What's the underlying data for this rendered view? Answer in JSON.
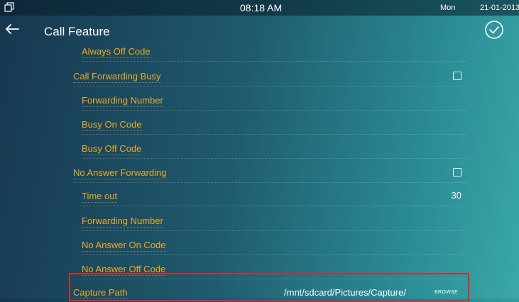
{
  "status_bar": {
    "time": "08:18 AM",
    "day": "Mon",
    "date": "21-01-2013",
    "left_icon": "window-restore-icon"
  },
  "header": {
    "title": "Call Feature",
    "back_icon": "back-arrow-icon",
    "confirm_icon": "check-circle-icon"
  },
  "settings": {
    "always_off_code": {
      "label": "Always Off Code"
    },
    "call_forwarding_busy": {
      "label": "Call Forwarding Busy",
      "checked": false
    },
    "busy_forwarding_number": {
      "label": "Forwarding Number"
    },
    "busy_on_code": {
      "label": "Busy On Code"
    },
    "busy_off_code": {
      "label": "Busy Off Code"
    },
    "no_answer_forwarding": {
      "label": "No Answer Forwarding",
      "checked": false
    },
    "time_out": {
      "label": "Time out",
      "value": "30"
    },
    "no_answer_forwarding_number": {
      "label": "Forwarding Number"
    },
    "no_answer_on_code": {
      "label": "No Answer On Code"
    },
    "no_answer_off_code": {
      "label": "No Answer Off Code"
    },
    "capture_path": {
      "label": "Capture Path",
      "value": "/mnt/sdcard/Pictures/Capture/",
      "browse_label": "BROWSE"
    }
  },
  "colors": {
    "label": "#f2a81c",
    "highlight_box": "#e0262b",
    "background_dark": "#17374f",
    "background_light": "#3aa7a8"
  }
}
